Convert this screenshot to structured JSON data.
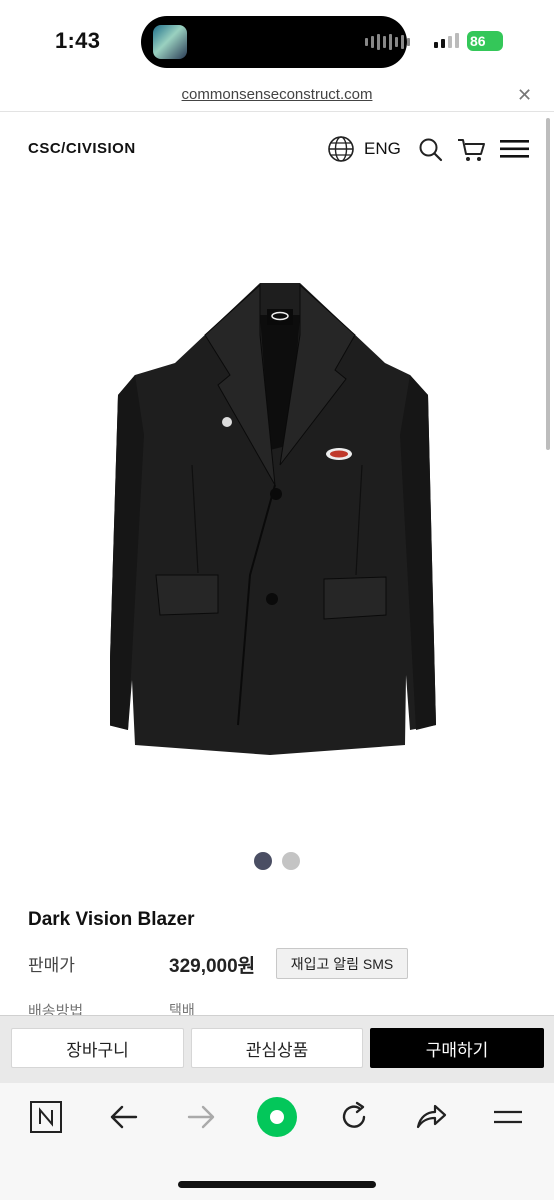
{
  "status_bar": {
    "time": "1:43",
    "battery": "86"
  },
  "browser": {
    "url": "commonsenseconstruct.com"
  },
  "header": {
    "logo": "CSC/CIVISION",
    "language": "ENG",
    "icons": [
      "globe-icon",
      "search-icon",
      "cart-icon",
      "hamburger-menu-icon"
    ]
  },
  "gallery": {
    "total_images": 2,
    "active_index": 0,
    "image_icon": "black-blazer-product-photo"
  },
  "product": {
    "name": "Dark Vision Blazer",
    "price_label": "판매가",
    "price": "329,000원",
    "restock_button": "재입고 알림 SMS",
    "shipping_label": "배송방법",
    "shipping_value": "택배"
  },
  "actions": {
    "cart": "장바구니",
    "wishlist": "관심상품",
    "buy": "구매하기"
  },
  "toolbar": {
    "icons": [
      "naver-n-icon",
      "back-arrow-icon",
      "forward-arrow-icon",
      "naver-green-home-icon",
      "reload-icon",
      "share-icon",
      "menu-icon"
    ]
  },
  "colors": {
    "buy_button": "#000000",
    "battery": "#34c759",
    "active_dot": "#4a4e63",
    "naver_green": "#03c75a"
  }
}
